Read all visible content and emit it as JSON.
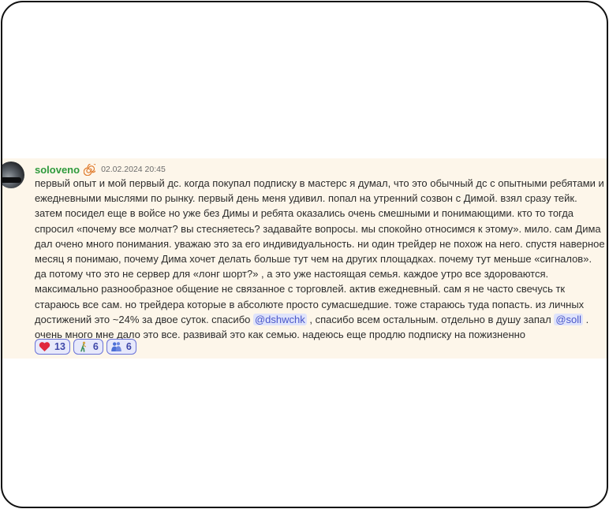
{
  "message": {
    "username": "soloveno",
    "badge_icon": "spiral-badge-icon",
    "timestamp": "02.02.2024 20:45",
    "text": {
      "part1": "первый опыт и мой первый дс. когда покупал подписку в мастерс я думал, что это обычный дс с опытными ребятами и ежедневными мыслями по рынку. первый день меня удивил. попал на утренний созвон с Димой. взял сразу тейк. затем посидел еще в войсе но уже без Димы и ребята оказались очень смешными и понимающими. кто то тогда спросил «почему все молчат? вы стесняетесь? задавайте вопросы. мы спокойно относимся к этому». мило. сам Дима дал очено много понимания. уважаю это за его индивидуальность. ни один трейдер не похож на него. спустя наверное месяц я понимаю, почему Дима хочет делать больше тут чем на других площадках. почему тут меньше «сигналов». да потому что это не сервер для «лонг шорт?» , а это уже настоящая семья. каждое утро все здороваются. максимально разнообразное общение не связанное с торговлей. актив ежедневный. сам я не часто свечусь тк стараюсь все сам. но трейдера которые в абсолюте просто сумасшедшие. тоже стараюсь туда попасть. из личных достижений это ~24% за двое суток. спасибо ",
      "mention1": "@dshwchk",
      "part2": " , спасибо всем остальным. отдельно в душу запал ",
      "mention2": "@soll",
      "part3": " . очень много мне дало это все. развивай это как семью. надеюсь еще продлю подписку на пожизненно"
    },
    "reactions": [
      {
        "icon": "heart-icon",
        "count": "13"
      },
      {
        "icon": "person-walking-icon",
        "count": "6"
      },
      {
        "icon": "hugging-people-icon",
        "count": "6"
      }
    ]
  },
  "colors": {
    "username": "#2e9a3c",
    "message_bg": "#fdf6ea",
    "mention_bg": "#dfe3fb",
    "mention_text": "#4a57c9",
    "reaction_border": "#6a73d8",
    "reaction_bg": "#e7e9fb",
    "heart": "#e0293c"
  }
}
